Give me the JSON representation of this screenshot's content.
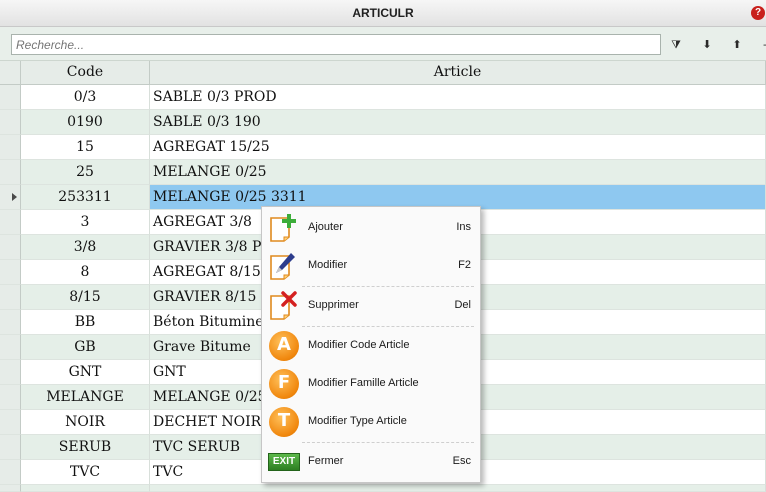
{
  "window": {
    "title": "ARTICULR",
    "help_icon": "question-icon"
  },
  "search": {
    "placeholder": "Recherche..."
  },
  "toolbar": [
    {
      "icon": "filter-icon",
      "glyph": "⧩"
    },
    {
      "icon": "arrow-down-icon",
      "glyph": "⬇"
    },
    {
      "icon": "arrow-up-icon",
      "glyph": "⬆"
    },
    {
      "icon": "more-icon",
      "glyph": "-"
    }
  ],
  "table": {
    "columns": [
      "Code",
      "Article"
    ],
    "rows": [
      {
        "code": "0/3",
        "article": "SABLE 0/3 PROD"
      },
      {
        "code": "0190",
        "article": "SABLE 0/3 190"
      },
      {
        "code": "15",
        "article": "AGREGAT 15/25"
      },
      {
        "code": "25",
        "article": "MELANGE 0/25"
      },
      {
        "code": "253311",
        "article": "MELANGE 0/25 3311"
      },
      {
        "code": "3",
        "article": "AGREGAT 3/8"
      },
      {
        "code": "3/8",
        "article": "GRAVIER 3/8 PR"
      },
      {
        "code": "8",
        "article": "AGREGAT 8/15"
      },
      {
        "code": "8/15",
        "article": "GRAVIER 8/15 P"
      },
      {
        "code": "BB",
        "article": "Béton Bitumineux"
      },
      {
        "code": "GB",
        "article": "Grave Bitume"
      },
      {
        "code": "GNT",
        "article": "GNT"
      },
      {
        "code": "MELANGE",
        "article": "MELANGE 0/25"
      },
      {
        "code": "NOIR",
        "article": "DECHET NOIR"
      },
      {
        "code": "SERUB",
        "article": "TVC SERUB"
      },
      {
        "code": "TVC",
        "article": "TVC"
      }
    ]
  },
  "context_menu": {
    "items": [
      {
        "label": "Ajouter",
        "shortcut": "Ins",
        "icon": "add-document-icon"
      },
      {
        "label": "Modifier",
        "shortcut": "F2",
        "icon": "edit-document-icon"
      },
      {
        "label": "Supprimer",
        "shortcut": "Del",
        "icon": "delete-document-icon"
      },
      {
        "label": "Modifier Code Article",
        "shortcut": "",
        "icon": "letter-a-icon",
        "letter": "A"
      },
      {
        "label": "Modifier Famille Article",
        "shortcut": "",
        "icon": "letter-f-icon",
        "letter": "F"
      },
      {
        "label": "Modifier Type Article",
        "shortcut": "",
        "icon": "letter-t-icon",
        "letter": "T"
      },
      {
        "label": "Fermer",
        "shortcut": "Esc",
        "icon": "exit-icon",
        "badge": "EXIT"
      }
    ]
  },
  "colors": {
    "selected_row": "#8ec8f0",
    "alt_row": "#e5efe8",
    "accent_orange": "#f0860c",
    "exit_green": "#2d7f22"
  }
}
